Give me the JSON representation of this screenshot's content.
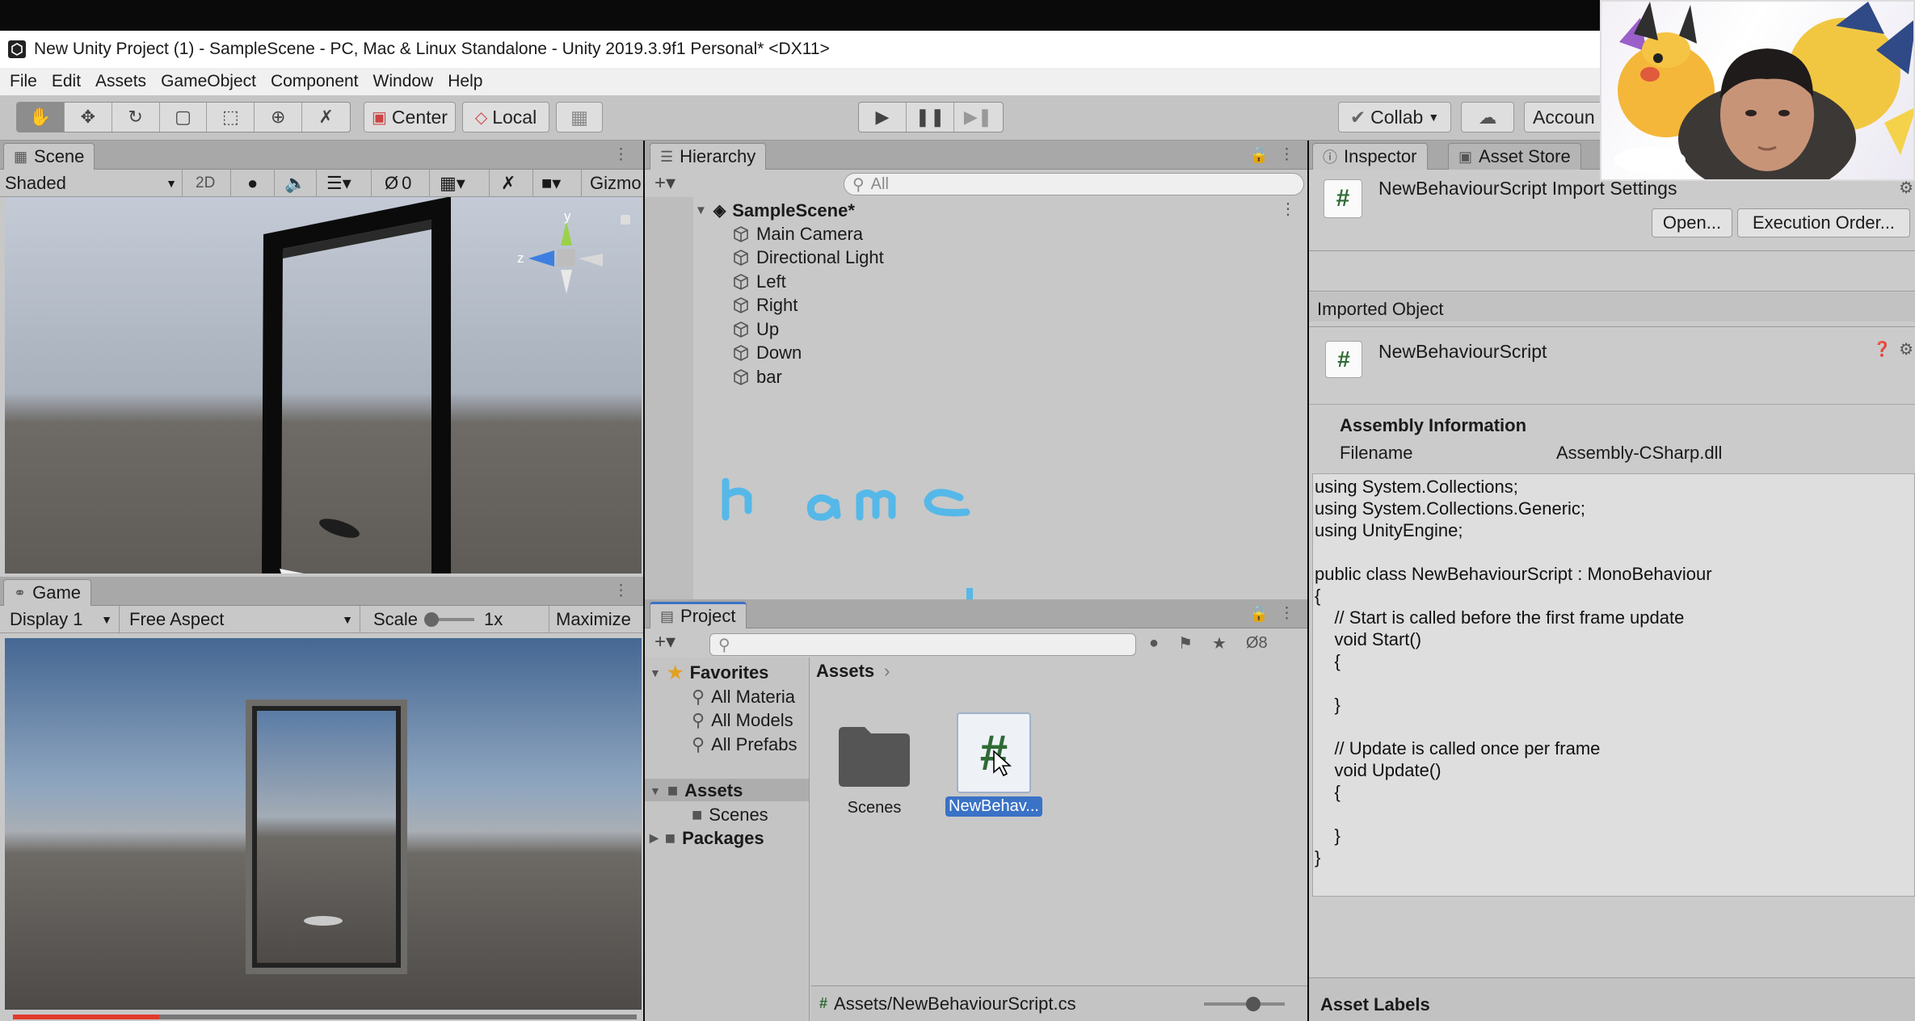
{
  "window": {
    "title": "New Unity Project (1) - SampleScene - PC, Mac & Linux Standalone - Unity 2019.3.9f1 Personal* <DX11>"
  },
  "menu": [
    "File",
    "Edit",
    "Assets",
    "GameObject",
    "Component",
    "Window",
    "Help"
  ],
  "toolbar": {
    "tools": [
      "hand-tool",
      "move-tool",
      "rotate-tool",
      "scale-tool",
      "rect-tool",
      "transform-tool",
      "custom-tool"
    ],
    "pivot_label": "Center",
    "space_label": "Local",
    "collab_label": "Collab",
    "account_label": "Accoun"
  },
  "scene": {
    "tab_label": "Scene",
    "shading": "Shaded",
    "mode_2d": "2D",
    "hidden_count": "0",
    "gizmos_label": "Gizmo",
    "axis_y": "y",
    "axis_z": "z"
  },
  "game": {
    "tab_label": "Game",
    "display": "Display 1",
    "aspect": "Free Aspect",
    "scale_label": "Scale",
    "scale_value": "1x",
    "maximize_label": "Maximize"
  },
  "hierarchy": {
    "tab_label": "Hierarchy",
    "search_placeholder": "All",
    "scene_name": "SampleScene*",
    "items": [
      "Main Camera",
      "Directional Light",
      "Left",
      "Right",
      "Up",
      "Down",
      "bar"
    ]
  },
  "annotation": {
    "handwritten": "name"
  },
  "project": {
    "tab_label": "Project",
    "hidden_count": "8",
    "favorites_label": "Favorites",
    "favorites": [
      "All Materia",
      "All Models",
      "All Prefabs"
    ],
    "assets_label": "Assets",
    "assets_children": [
      "Scenes"
    ],
    "packages_label": "Packages",
    "breadcrumb": "Assets",
    "grid_items": [
      {
        "label": "Scenes",
        "type": "folder"
      },
      {
        "label": "NewBehav...",
        "type": "script"
      }
    ],
    "footer_path": "Assets/NewBehaviourScript.cs"
  },
  "inspector": {
    "tab_label": "Inspector",
    "store_tab_label": "Asset Store",
    "header_title": "NewBehaviourScript Import Settings",
    "open_label": "Open...",
    "exec_order_label": "Execution Order...",
    "imported_object_label": "Imported Object",
    "object_name": "NewBehaviourScript",
    "assembly_heading": "Assembly Information",
    "filename_label": "Filename",
    "filename_value": "Assembly-CSharp.dll",
    "code": "using System.Collections;\nusing System.Collections.Generic;\nusing UnityEngine;\n\npublic class NewBehaviourScript : MonoBehaviour\n{\n    // Start is called before the first frame update\n    void Start()\n    {\n\n    }\n\n    // Update is called once per frame\n    void Update()\n    {\n\n    }\n}",
    "asset_labels": "Asset Labels"
  },
  "icons": {
    "script_glyph": "#"
  },
  "colors": {
    "selection": "#3a72c6",
    "annotation": "#55b8e8",
    "video_progress": "#e03a2c"
  },
  "video_progress": 0.235
}
